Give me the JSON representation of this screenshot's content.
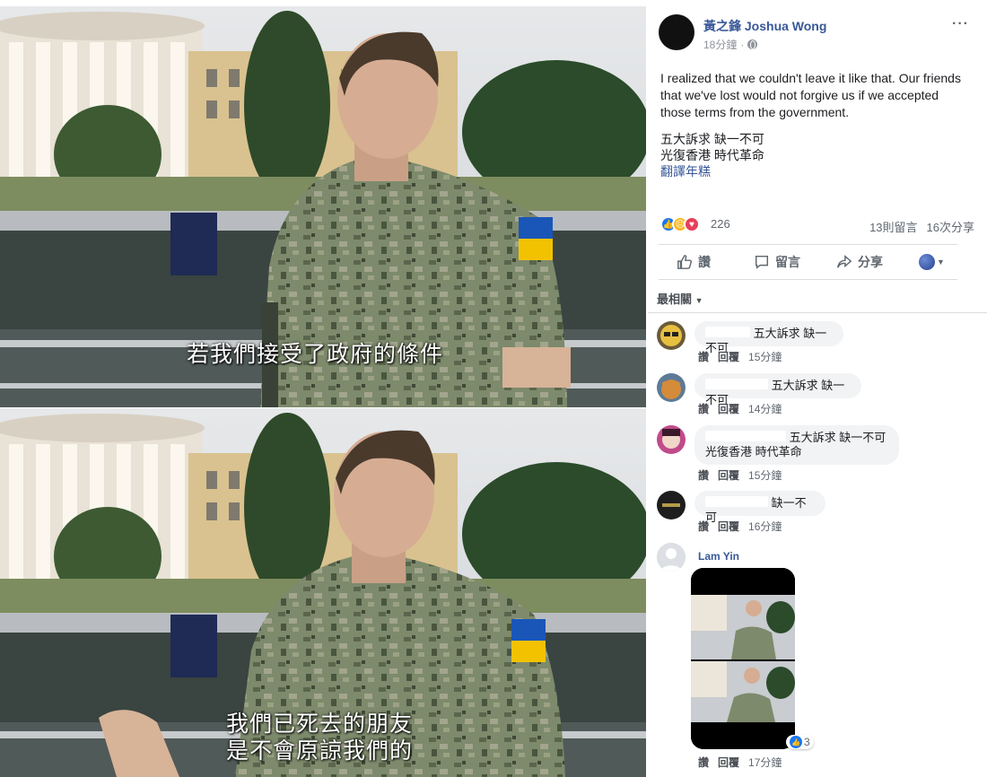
{
  "video": {
    "subtitle_1": "若我們接受了政府的條件",
    "subtitle_2_line1": "我們已死去的朋友",
    "subtitle_2_line2": "是不會原諒我們的"
  },
  "post": {
    "author": "黃之鋒 Joshua Wong",
    "time": "18分鐘",
    "more_icon": "···",
    "text": "I realized that we couldn't leave it like that. Our friends that we've lost would not forgive us if we accepted those terms from the government.",
    "tag_line1": "五大訴求 缺一不可",
    "tag_line2": "光復香港 時代革命",
    "translate_label": "翻譯年糕"
  },
  "reactions": {
    "count": "226",
    "comments": "13則留言",
    "shares": "16次分享",
    "icons": [
      "like-icon",
      "sad-icon",
      "love-icon"
    ]
  },
  "actions": {
    "like": "讚",
    "comment": "留言",
    "share": "分享"
  },
  "sort_label": "最相關",
  "comments": [
    {
      "text": "五大訴求 缺一不可",
      "like": "讚",
      "reply": "回覆",
      "time": "15分鐘"
    },
    {
      "text": "五大訴求 缺一不可",
      "like": "讚",
      "reply": "回覆",
      "time": "14分鐘"
    },
    {
      "line1": "五大訴求 缺一不可",
      "line2": "光復香港 時代革命",
      "like": "讚",
      "reply": "回覆",
      "time": "15分鐘"
    },
    {
      "text": "缺一不可",
      "like": "讚",
      "reply": "回覆",
      "time": "16分鐘"
    },
    {
      "name": "Lam Yin",
      "reaction_count": "3",
      "like": "讚",
      "reply": "回覆",
      "time": "17分鐘"
    }
  ],
  "colors": {
    "link": "#385898",
    "muted": "#90949c",
    "bubble": "#f2f3f5",
    "like_blue": "#1877f2"
  }
}
